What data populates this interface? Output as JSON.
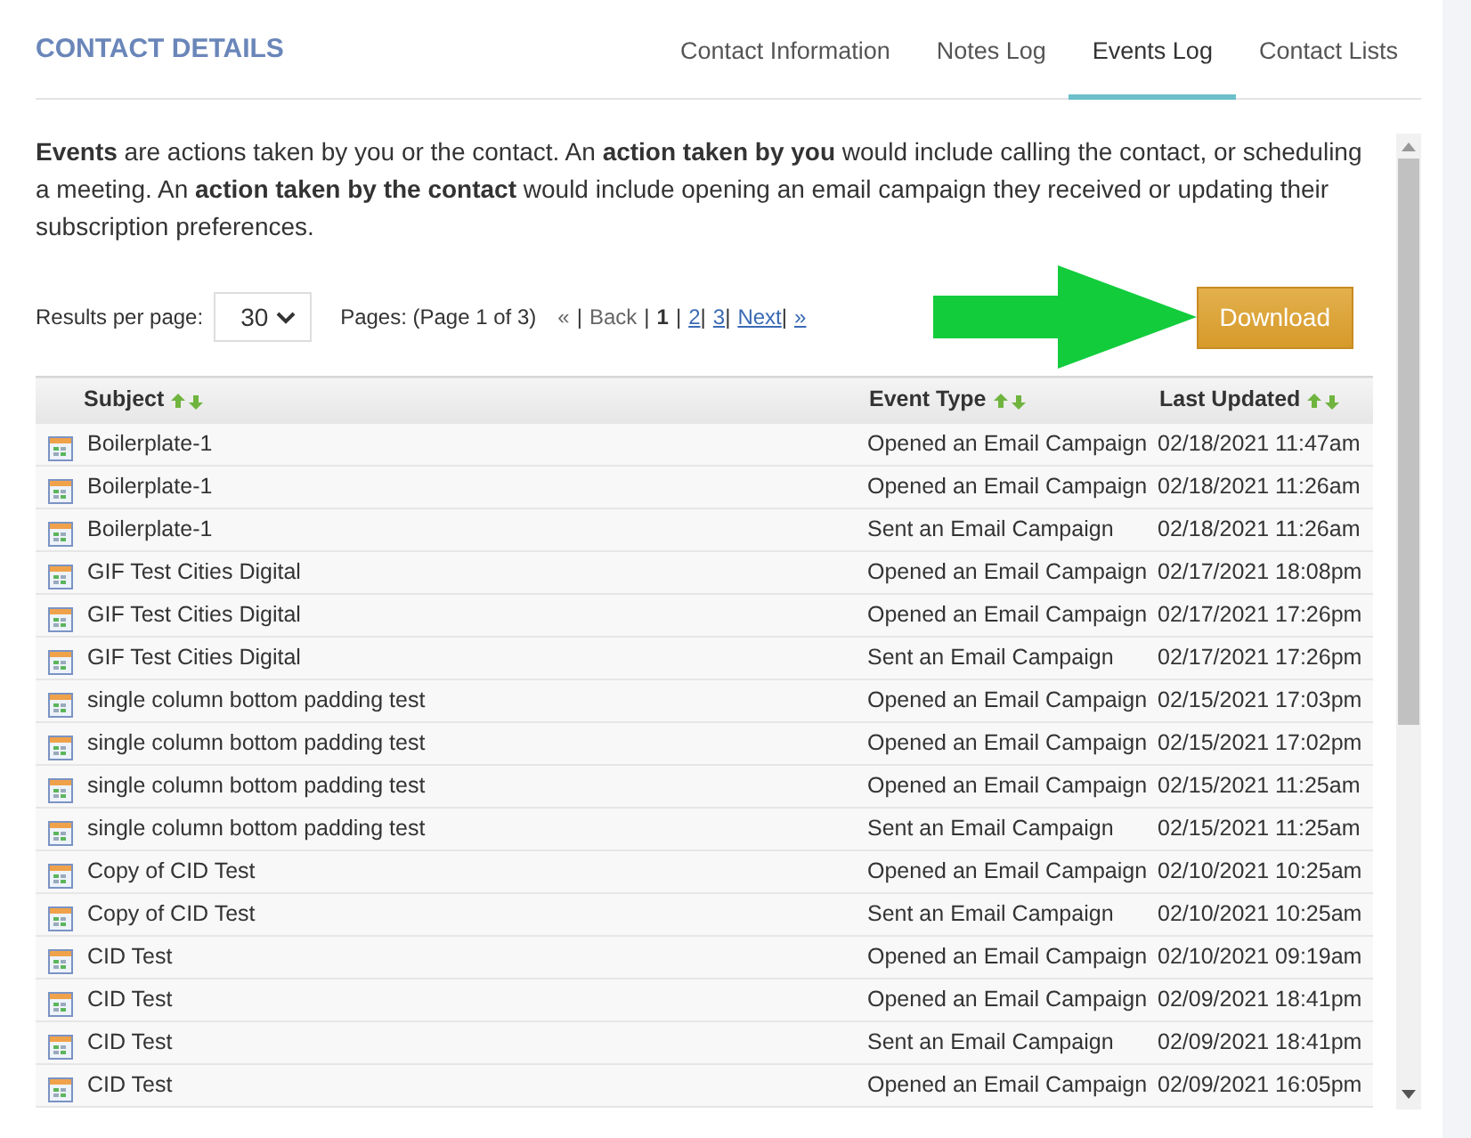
{
  "title": "CONTACT DETAILS",
  "tabs": [
    {
      "label": "Contact Information",
      "selected": false
    },
    {
      "label": "Notes Log",
      "selected": false
    },
    {
      "label": "Events Log",
      "selected": true
    },
    {
      "label": "Contact Lists",
      "selected": false
    }
  ],
  "description": "**Events** are actions taken by you or the contact. An **action taken by you** would include calling the contact, or scheduling a meeting. An **action taken by the contact** would include opening an email campaign they received or updating their subscription preferences.",
  "results_per_page": {
    "label": "Results per page:",
    "value": "30"
  },
  "pages_label": "Pages: (Page 1 of 3)",
  "pager": [
    {
      "label": "«",
      "kind": "disabled"
    },
    {
      "label": "|",
      "kind": "separator"
    },
    {
      "label": "Back",
      "kind": "disabled"
    },
    {
      "label": "|",
      "kind": "separator"
    },
    {
      "label": "1",
      "kind": "current"
    },
    {
      "label": "|",
      "kind": "separator"
    },
    {
      "label": "2",
      "kind": "link"
    },
    {
      "label": "|",
      "kind": "separator"
    },
    {
      "label": "3",
      "kind": "link"
    },
    {
      "label": "|",
      "kind": "separator"
    },
    {
      "label": "Next",
      "kind": "link"
    },
    {
      "label": "|",
      "kind": "separator"
    },
    {
      "label": "»",
      "kind": "link"
    }
  ],
  "download_button": "Download",
  "table": {
    "columns": [
      {
        "label": "Subject",
        "sortable": true
      },
      {
        "label": "Event Type",
        "sortable": true
      },
      {
        "label": "Last Updated",
        "sortable": true
      }
    ],
    "rows": [
      [
        "Boilerplate-1",
        "Opened an Email Campaign",
        "02/18/2021 11:47am"
      ],
      [
        "Boilerplate-1",
        "Opened an Email Campaign",
        "02/18/2021 11:26am"
      ],
      [
        "Boilerplate-1",
        "Sent an Email Campaign",
        "02/18/2021 11:26am"
      ],
      [
        "GIF Test Cities Digital",
        "Opened an Email Campaign",
        "02/17/2021 18:08pm"
      ],
      [
        "GIF Test Cities Digital",
        "Opened an Email Campaign",
        "02/17/2021 17:26pm"
      ],
      [
        "GIF Test Cities Digital",
        "Sent an Email Campaign",
        "02/17/2021 17:26pm"
      ],
      [
        "single column bottom padding test",
        "Opened an Email Campaign",
        "02/15/2021 17:03pm"
      ],
      [
        "single column bottom padding test",
        "Opened an Email Campaign",
        "02/15/2021 17:02pm"
      ],
      [
        "single column bottom padding test",
        "Opened an Email Campaign",
        "02/15/2021 11:25am"
      ],
      [
        "single column bottom padding test",
        "Sent an Email Campaign",
        "02/15/2021 11:25am"
      ],
      [
        "Copy of CID Test",
        "Opened an Email Campaign",
        "02/10/2021 10:25am"
      ],
      [
        "Copy of CID Test",
        "Sent an Email Campaign",
        "02/10/2021 10:25am"
      ],
      [
        "CID Test",
        "Opened an Email Campaign",
        "02/10/2021 09:19am"
      ],
      [
        "CID Test",
        "Opened an Email Campaign",
        "02/09/2021 18:41pm"
      ],
      [
        "CID Test",
        "Sent an Email Campaign",
        "02/09/2021 18:41pm"
      ],
      [
        "CID Test",
        "Opened an Email Campaign",
        "02/09/2021 16:05pm"
      ]
    ]
  }
}
